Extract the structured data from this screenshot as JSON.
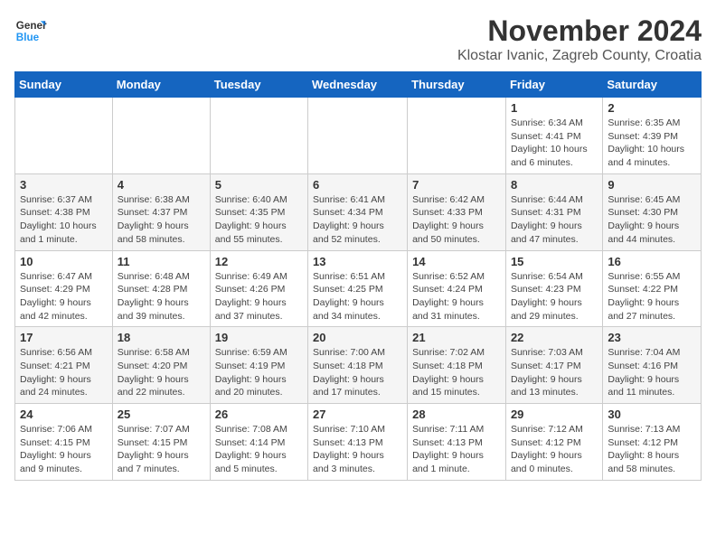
{
  "header": {
    "logo_general": "General",
    "logo_blue": "Blue",
    "month_title": "November 2024",
    "location": "Klostar Ivanic, Zagreb County, Croatia"
  },
  "days_of_week": [
    "Sunday",
    "Monday",
    "Tuesday",
    "Wednesday",
    "Thursday",
    "Friday",
    "Saturday"
  ],
  "weeks": [
    [
      {
        "day": "",
        "info": ""
      },
      {
        "day": "",
        "info": ""
      },
      {
        "day": "",
        "info": ""
      },
      {
        "day": "",
        "info": ""
      },
      {
        "day": "",
        "info": ""
      },
      {
        "day": "1",
        "info": "Sunrise: 6:34 AM\nSunset: 4:41 PM\nDaylight: 10 hours and 6 minutes."
      },
      {
        "day": "2",
        "info": "Sunrise: 6:35 AM\nSunset: 4:39 PM\nDaylight: 10 hours and 4 minutes."
      }
    ],
    [
      {
        "day": "3",
        "info": "Sunrise: 6:37 AM\nSunset: 4:38 PM\nDaylight: 10 hours and 1 minute."
      },
      {
        "day": "4",
        "info": "Sunrise: 6:38 AM\nSunset: 4:37 PM\nDaylight: 9 hours and 58 minutes."
      },
      {
        "day": "5",
        "info": "Sunrise: 6:40 AM\nSunset: 4:35 PM\nDaylight: 9 hours and 55 minutes."
      },
      {
        "day": "6",
        "info": "Sunrise: 6:41 AM\nSunset: 4:34 PM\nDaylight: 9 hours and 52 minutes."
      },
      {
        "day": "7",
        "info": "Sunrise: 6:42 AM\nSunset: 4:33 PM\nDaylight: 9 hours and 50 minutes."
      },
      {
        "day": "8",
        "info": "Sunrise: 6:44 AM\nSunset: 4:31 PM\nDaylight: 9 hours and 47 minutes."
      },
      {
        "day": "9",
        "info": "Sunrise: 6:45 AM\nSunset: 4:30 PM\nDaylight: 9 hours and 44 minutes."
      }
    ],
    [
      {
        "day": "10",
        "info": "Sunrise: 6:47 AM\nSunset: 4:29 PM\nDaylight: 9 hours and 42 minutes."
      },
      {
        "day": "11",
        "info": "Sunrise: 6:48 AM\nSunset: 4:28 PM\nDaylight: 9 hours and 39 minutes."
      },
      {
        "day": "12",
        "info": "Sunrise: 6:49 AM\nSunset: 4:26 PM\nDaylight: 9 hours and 37 minutes."
      },
      {
        "day": "13",
        "info": "Sunrise: 6:51 AM\nSunset: 4:25 PM\nDaylight: 9 hours and 34 minutes."
      },
      {
        "day": "14",
        "info": "Sunrise: 6:52 AM\nSunset: 4:24 PM\nDaylight: 9 hours and 31 minutes."
      },
      {
        "day": "15",
        "info": "Sunrise: 6:54 AM\nSunset: 4:23 PM\nDaylight: 9 hours and 29 minutes."
      },
      {
        "day": "16",
        "info": "Sunrise: 6:55 AM\nSunset: 4:22 PM\nDaylight: 9 hours and 27 minutes."
      }
    ],
    [
      {
        "day": "17",
        "info": "Sunrise: 6:56 AM\nSunset: 4:21 PM\nDaylight: 9 hours and 24 minutes."
      },
      {
        "day": "18",
        "info": "Sunrise: 6:58 AM\nSunset: 4:20 PM\nDaylight: 9 hours and 22 minutes."
      },
      {
        "day": "19",
        "info": "Sunrise: 6:59 AM\nSunset: 4:19 PM\nDaylight: 9 hours and 20 minutes."
      },
      {
        "day": "20",
        "info": "Sunrise: 7:00 AM\nSunset: 4:18 PM\nDaylight: 9 hours and 17 minutes."
      },
      {
        "day": "21",
        "info": "Sunrise: 7:02 AM\nSunset: 4:18 PM\nDaylight: 9 hours and 15 minutes."
      },
      {
        "day": "22",
        "info": "Sunrise: 7:03 AM\nSunset: 4:17 PM\nDaylight: 9 hours and 13 minutes."
      },
      {
        "day": "23",
        "info": "Sunrise: 7:04 AM\nSunset: 4:16 PM\nDaylight: 9 hours and 11 minutes."
      }
    ],
    [
      {
        "day": "24",
        "info": "Sunrise: 7:06 AM\nSunset: 4:15 PM\nDaylight: 9 hours and 9 minutes."
      },
      {
        "day": "25",
        "info": "Sunrise: 7:07 AM\nSunset: 4:15 PM\nDaylight: 9 hours and 7 minutes."
      },
      {
        "day": "26",
        "info": "Sunrise: 7:08 AM\nSunset: 4:14 PM\nDaylight: 9 hours and 5 minutes."
      },
      {
        "day": "27",
        "info": "Sunrise: 7:10 AM\nSunset: 4:13 PM\nDaylight: 9 hours and 3 minutes."
      },
      {
        "day": "28",
        "info": "Sunrise: 7:11 AM\nSunset: 4:13 PM\nDaylight: 9 hours and 1 minute."
      },
      {
        "day": "29",
        "info": "Sunrise: 7:12 AM\nSunset: 4:12 PM\nDaylight: 9 hours and 0 minutes."
      },
      {
        "day": "30",
        "info": "Sunrise: 7:13 AM\nSunset: 4:12 PM\nDaylight: 8 hours and 58 minutes."
      }
    ]
  ]
}
